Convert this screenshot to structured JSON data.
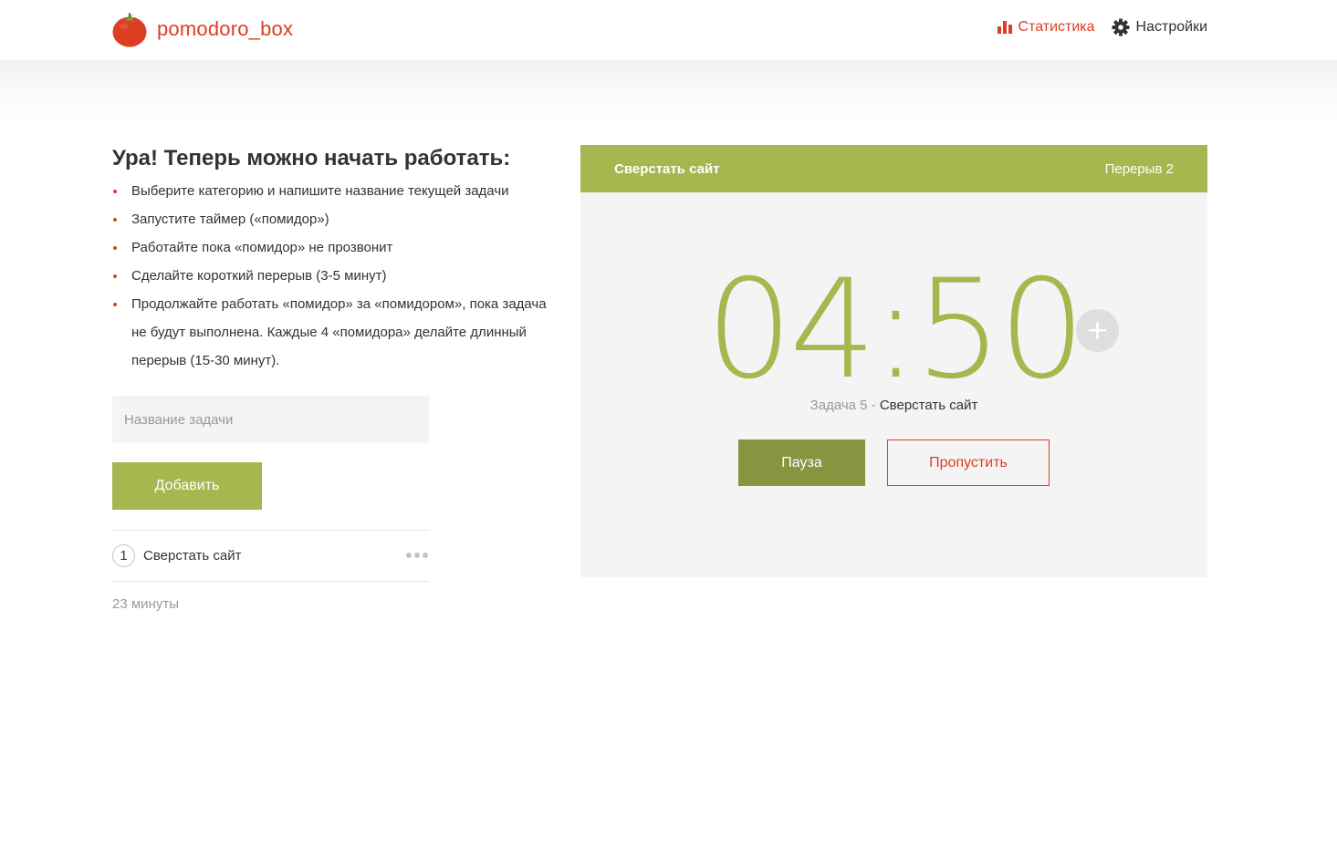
{
  "header": {
    "logo_text": "pomodoro_box",
    "nav": {
      "stats_label": "Статистика",
      "settings_label": "Настройки"
    }
  },
  "instructions": {
    "title": "Ура! Теперь можно начать работать:",
    "steps": [
      "Выберите категорию и напишите название текущей задачи",
      "Запустите таймер («помидор»)",
      "Работайте пока «помидор» не прозвонит",
      "Сделайте короткий перерыв (3-5 минут)",
      "Продолжайте работать «помидор» за «помидором», пока задача не будут выполнена. Каждые 4 «помидора» делайте длинный перерыв (15-30 минут)."
    ]
  },
  "task_form": {
    "placeholder": "Название задачи",
    "input_value": "",
    "add_label": "Добавить"
  },
  "task_list": {
    "items": [
      {
        "count": "1",
        "name": "Сверстать сайт"
      }
    ],
    "total_time": "23 минуты"
  },
  "timer": {
    "header_title": "Сверстать сайт",
    "header_status": "Перерыв 2",
    "time": "04:50",
    "plus_label": "+",
    "task_prefix": "Задача 5 - ",
    "task_name": "Сверстать сайт",
    "pause_label": "Пауза",
    "skip_label": "Пропустить"
  },
  "colors": {
    "accent_red": "#DC3E22",
    "accent_green": "#A8B64F",
    "dark_green": "#899441",
    "panel_bg": "#F4F4F4"
  },
  "icons": {
    "logo": "tomato-icon",
    "stats": "bar-chart-icon",
    "settings": "gear-icon",
    "task_menu": "more-dots-icon",
    "add_time": "plus-icon"
  }
}
